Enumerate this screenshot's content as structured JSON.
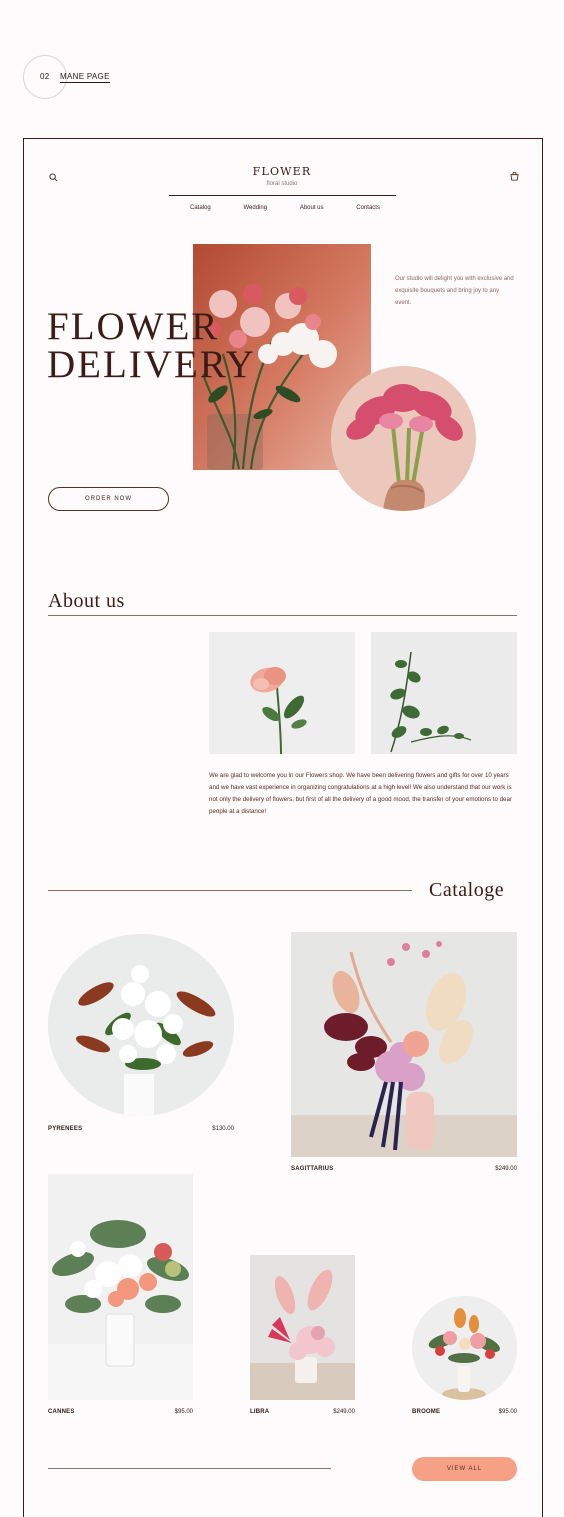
{
  "badge": {
    "number": "02",
    "title": "MANE PAGE"
  },
  "header": {
    "logo": "FLOWER",
    "subtitle": "floral studio",
    "nav": [
      "Catalog",
      "Wedding",
      "About us",
      "Contacts"
    ]
  },
  "hero": {
    "title_line1": "FLOWER",
    "title_line2": "DELIVERY",
    "description": "Our studio will delight you with exclusive and exquisite bouquets and bring joy to any event.",
    "order_button": "ORDER NOW"
  },
  "about": {
    "title": "About us",
    "text": "We are glad to welcome you in our Flowers shop. We have been delivering flowers and gifts for over 10 years and we have vast experience in organizing congratulations at a high level! We also understand that our work is not only the delivery of flowers, but first of all the delivery of a good mood, the transfer of your emotions to dear people at a distance!"
  },
  "catalog": {
    "title": "Cataloge",
    "products": [
      {
        "name": "PYRENEES",
        "price": "$130.00"
      },
      {
        "name": "SAGITTARIUS",
        "price": "$249.00"
      },
      {
        "name": "CANNES",
        "price": "$95.00"
      },
      {
        "name": "LIBRA",
        "price": "$249.00"
      },
      {
        "name": "BROOME",
        "price": "$95.00"
      }
    ],
    "view_all": "VIEW ALL"
  },
  "colors": {
    "accent": "#f6a185",
    "text": "#3a1d18",
    "frame": "#3a1d18"
  }
}
